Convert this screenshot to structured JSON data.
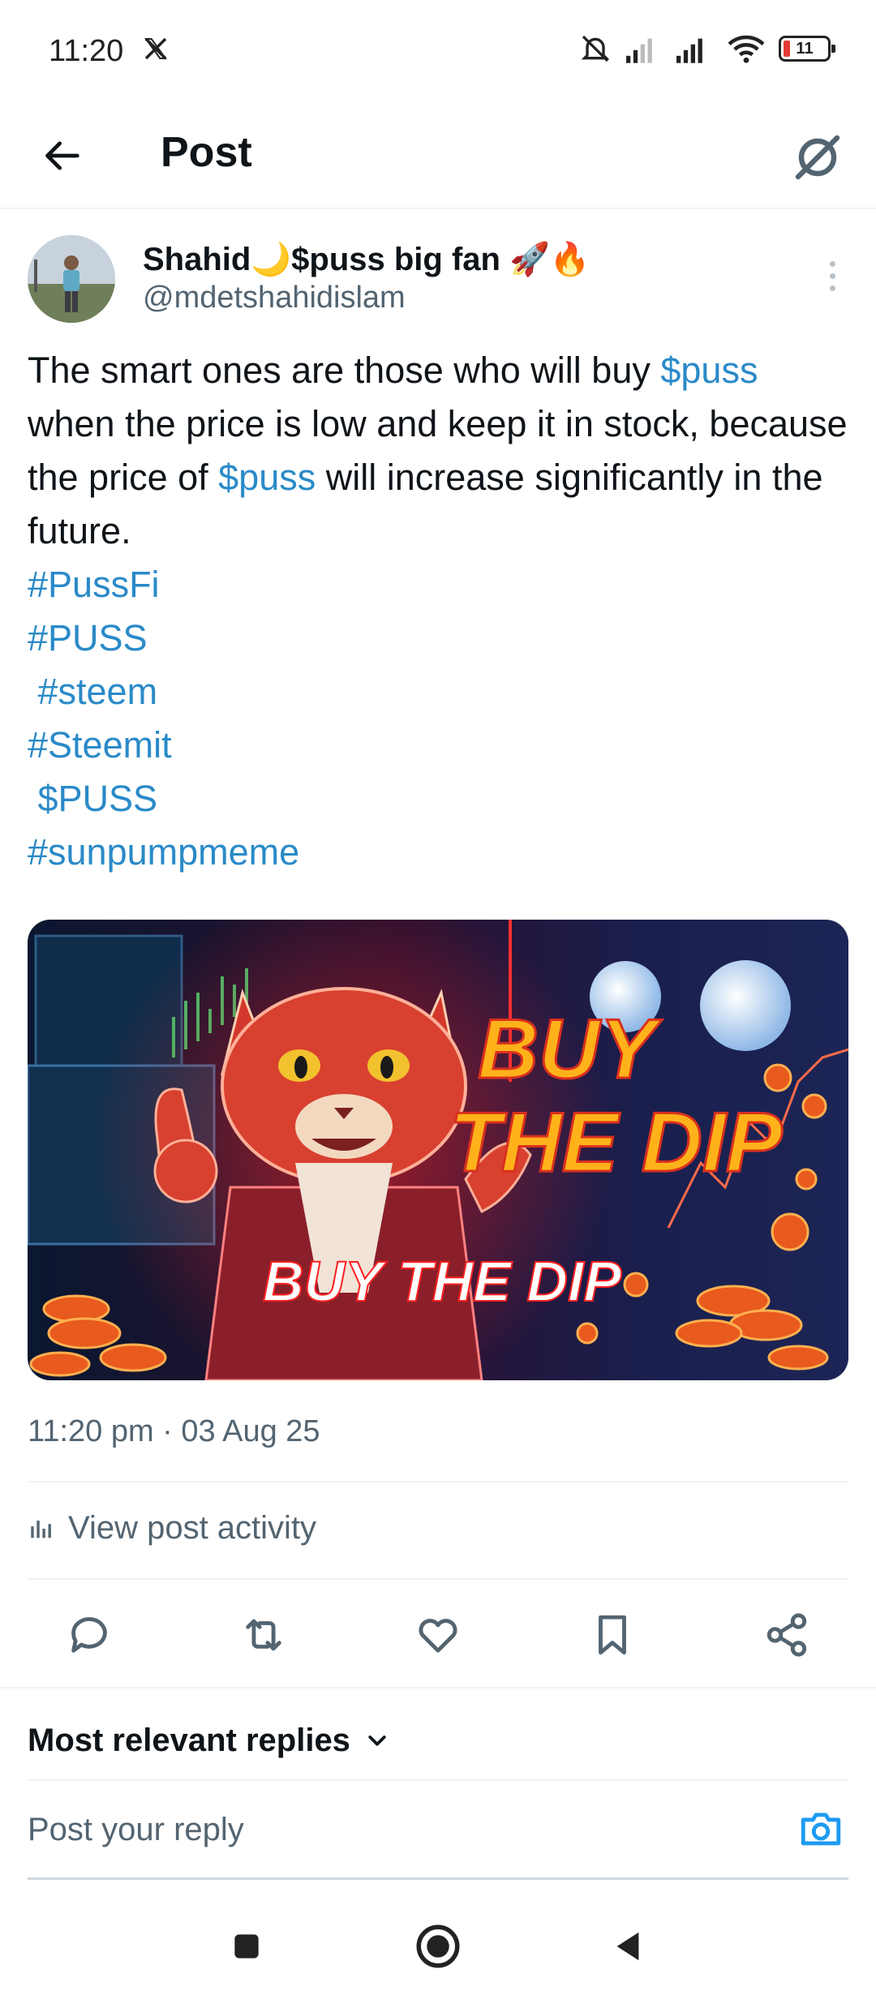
{
  "status_bar": {
    "time": "11:20",
    "battery": "11"
  },
  "header": {
    "title": "Post"
  },
  "author": {
    "name": "Shahid🌙$puss big fan 🚀🔥",
    "handle": "@mdetshahidislam"
  },
  "post": {
    "text_1": "The smart ones are those who will buy ",
    "cashtag_1": "$puss",
    "text_2": " when the price is low and keep it in stock, because the price of ",
    "cashtag_2": "$puss",
    "text_3": " will increase significantly in the future.",
    "tags": [
      "#PussFi",
      "#PUSS",
      " #steem",
      "#Steemit",
      " $PUSS",
      "#sunpumpmeme"
    ],
    "image_text_main_1": "BUY",
    "image_text_main_2": "THE DIP",
    "image_text_banner": "BUY THE DIP",
    "timestamp": "11:20 pm · 03 Aug 25",
    "activity_label": "View post activity"
  },
  "replies": {
    "sort_label": "Most relevant replies",
    "input_placeholder": "Post your reply"
  },
  "colors": {
    "link": "#2a8ac8",
    "text": "#0f1419",
    "muted": "#536471",
    "accent": "#1d9bf0"
  }
}
